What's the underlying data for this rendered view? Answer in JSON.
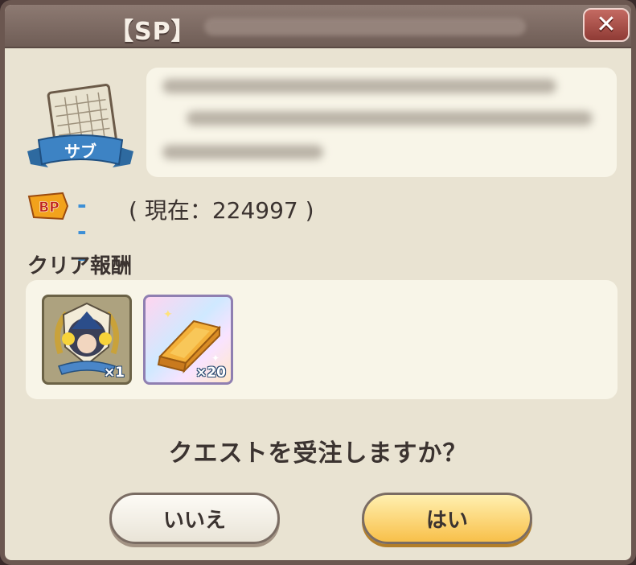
{
  "dialog": {
    "title": "【SP】",
    "close_label": "✕"
  },
  "quest": {
    "category_badge": "サブ"
  },
  "bp": {
    "badge": "BP",
    "value": "---",
    "current_text": "( 現在：224997 )"
  },
  "rewards": {
    "label": "クリア報酬",
    "items": [
      {
        "icon": "character-medal-icon",
        "quantity": "×1"
      },
      {
        "icon": "gold-bar-icon",
        "quantity": "×20"
      }
    ]
  },
  "prompt": {
    "question": "クエストを受注しますか？",
    "no_label": "いいえ",
    "yes_label": "はい"
  },
  "colors": {
    "panel_bg": "#e9e3d2",
    "titlebar": "#7d6a62",
    "close_button": "#a64c45",
    "bp_dashes": "#3c8fd6",
    "yes_button": "#f8c04a"
  }
}
